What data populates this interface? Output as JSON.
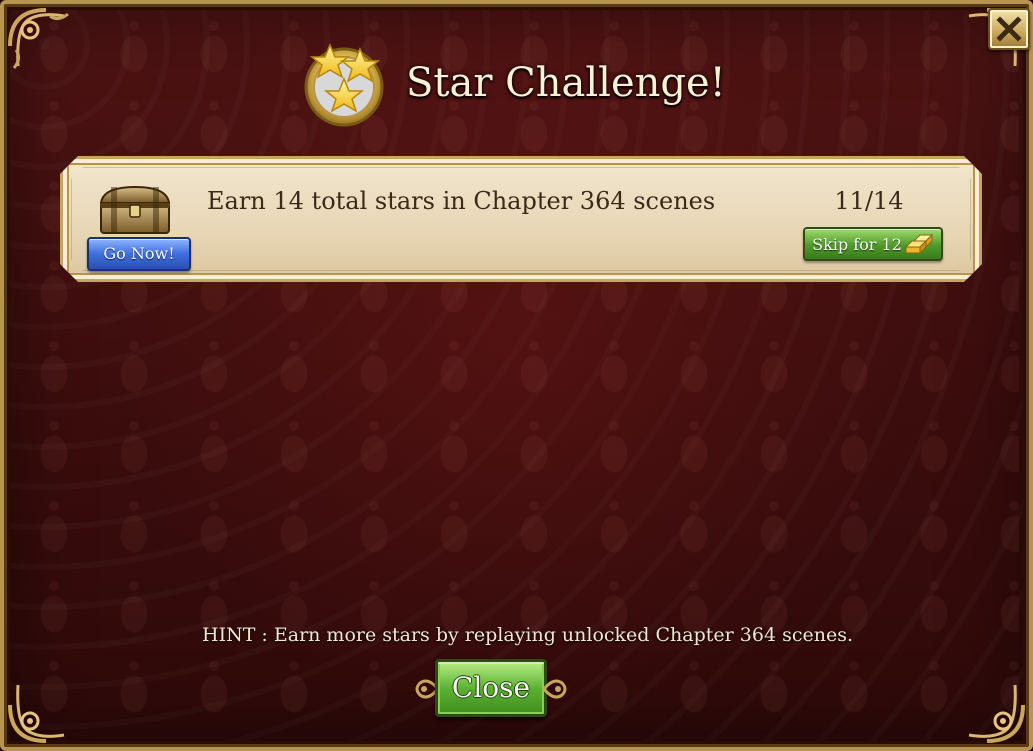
{
  "dialog": {
    "title": "Star Challenge!",
    "close_icon": "close-x-icon"
  },
  "task": {
    "description": "Earn 14 total stars in Chapter 364 scenes",
    "progress_text": "11/14",
    "progress_current": 11,
    "progress_total": 14,
    "go_label": "Go Now!",
    "skip_label": "Skip for 12",
    "skip_cost_icon": "gold-bars-icon"
  },
  "footer": {
    "hint": "HINT : Earn more stars by replaying unlocked Chapter 364 scenes.",
    "close_label": "Close"
  },
  "colors": {
    "background": "#3d0d0d",
    "frame_gold": "#b59456",
    "card": "#e9d8b8",
    "blue_button": "#3e6fdc",
    "green_button": "#5cb233"
  }
}
